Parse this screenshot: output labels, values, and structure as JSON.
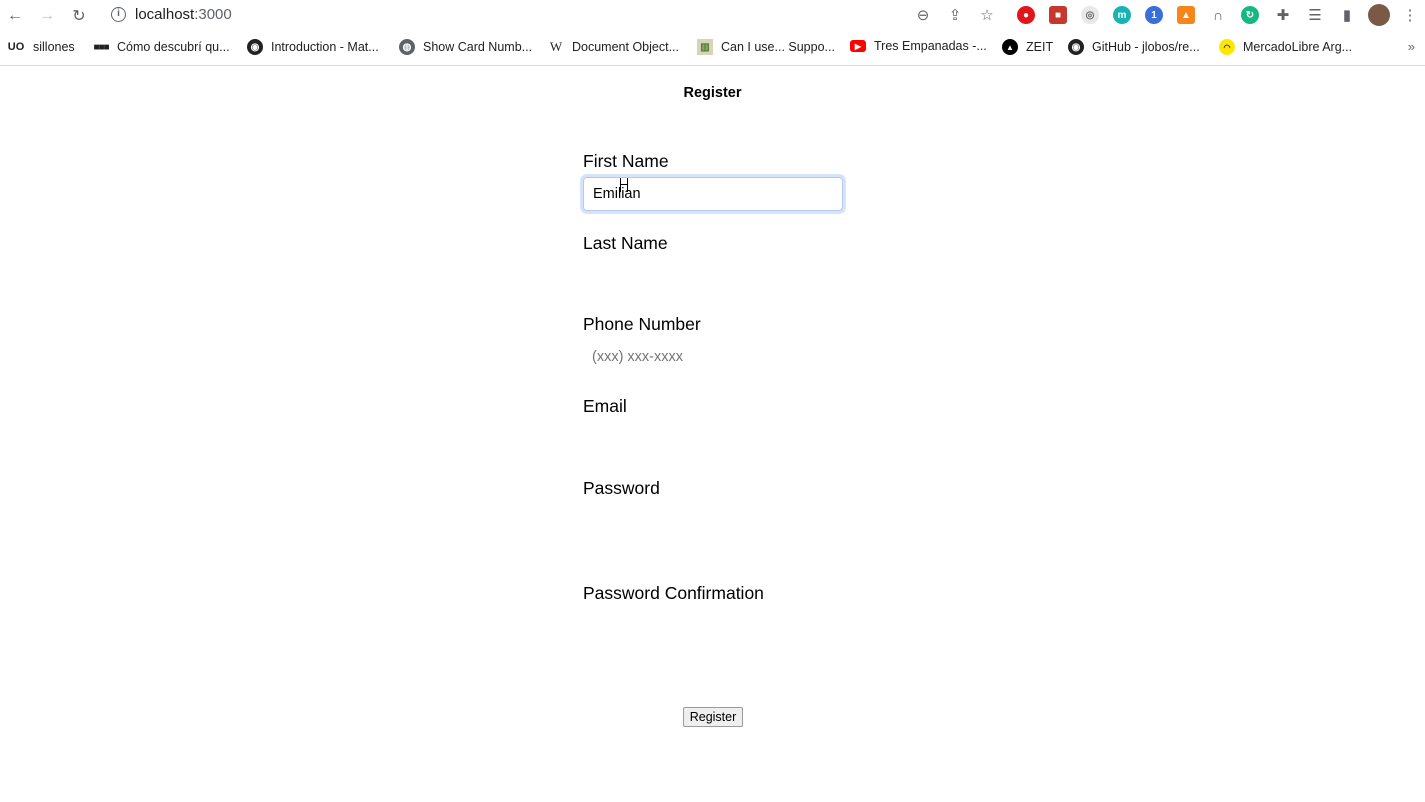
{
  "browser": {
    "url_host": "localhost",
    "url_port": ":3000",
    "bookmarks": [
      {
        "label": "sillones",
        "icon": "UO"
      },
      {
        "label": "Cómo descubrí qu...",
        "icon": "dots-icon"
      },
      {
        "label": "Introduction - Mat...",
        "icon": "github-icon"
      },
      {
        "label": "Show Card Numb...",
        "icon": "globe-icon"
      },
      {
        "label": "Document Object...",
        "icon": "W"
      },
      {
        "label": "Can I use... Suppo...",
        "icon": "caniuse-icon"
      },
      {
        "label": "Tres Empanadas -...",
        "icon": "youtube-icon"
      },
      {
        "label": "ZEIT",
        "icon": "zeit-icon"
      },
      {
        "label": "GitHub - jlobos/re...",
        "icon": "github-icon"
      },
      {
        "label": "MercadoLibre Arg...",
        "icon": "mercadolibre-icon"
      }
    ],
    "more": "»"
  },
  "form": {
    "title": "Register",
    "fields": [
      {
        "label": "First Name",
        "value": "Emilian",
        "placeholder": ""
      },
      {
        "label": "Last Name",
        "value": "",
        "placeholder": ""
      },
      {
        "label": "Phone Number",
        "value": "",
        "placeholder": "(xxx) xxx-xxxx"
      },
      {
        "label": "Email",
        "value": "",
        "placeholder": ""
      },
      {
        "label": "Password",
        "value": "",
        "placeholder": ""
      },
      {
        "label": "Password Confirmation",
        "value": "",
        "placeholder": ""
      }
    ],
    "submit_label": "Register"
  }
}
